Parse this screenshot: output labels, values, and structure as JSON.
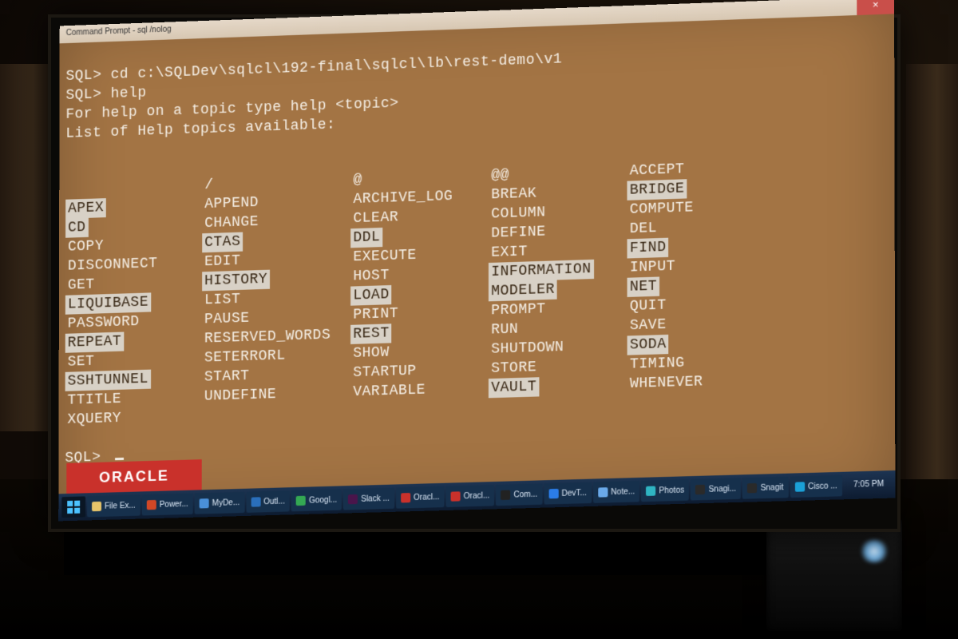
{
  "window": {
    "title": "Command Prompt - sql /nolog",
    "close_glyph": "×"
  },
  "terminal": {
    "prompt": "SQL>",
    "cmd_cd": "cd c:\\SQLDev\\sqlcl\\192-final\\sqlcl\\lb\\rest-demo\\v1",
    "cmd_help": "help",
    "help_hint": "For help on a topic type help <topic>",
    "help_header": "List of Help topics available:",
    "columns": [
      {
        "header": "",
        "items": [
          {
            "t": "APEX",
            "h": 1
          },
          {
            "t": "CD",
            "h": 1
          },
          {
            "t": "COPY",
            "h": 0
          },
          {
            "t": "DISCONNECT",
            "h": 0
          },
          {
            "t": "GET",
            "h": 0
          },
          {
            "t": "LIQUIBASE",
            "h": 1
          },
          {
            "t": "PASSWORD",
            "h": 0
          },
          {
            "t": "REPEAT",
            "h": 1
          },
          {
            "t": "SET",
            "h": 0
          },
          {
            "t": "SSHTUNNEL",
            "h": 1
          },
          {
            "t": "TTITLE",
            "h": 0
          },
          {
            "t": "XQUERY",
            "h": 0
          }
        ]
      },
      {
        "header": "/",
        "items": [
          {
            "t": "APPEND",
            "h": 0
          },
          {
            "t": "CHANGE",
            "h": 0
          },
          {
            "t": "CTAS",
            "h": 1
          },
          {
            "t": "EDIT",
            "h": 0
          },
          {
            "t": "HISTORY",
            "h": 1
          },
          {
            "t": "LIST",
            "h": 0
          },
          {
            "t": "PAUSE",
            "h": 0
          },
          {
            "t": "RESERVED_WORDS",
            "h": 0
          },
          {
            "t": "SETERRORL",
            "h": 0
          },
          {
            "t": "START",
            "h": 0
          },
          {
            "t": "UNDEFINE",
            "h": 0
          }
        ]
      },
      {
        "header": "@",
        "items": [
          {
            "t": "ARCHIVE_LOG",
            "h": 0
          },
          {
            "t": "CLEAR",
            "h": 0
          },
          {
            "t": "DDL",
            "h": 1
          },
          {
            "t": "EXECUTE",
            "h": 0
          },
          {
            "t": "HOST",
            "h": 0
          },
          {
            "t": "LOAD",
            "h": 1
          },
          {
            "t": "PRINT",
            "h": 0
          },
          {
            "t": "REST",
            "h": 1
          },
          {
            "t": "SHOW",
            "h": 0
          },
          {
            "t": "STARTUP",
            "h": 0
          },
          {
            "t": "VARIABLE",
            "h": 0
          }
        ]
      },
      {
        "header": "@@",
        "items": [
          {
            "t": "BREAK",
            "h": 0
          },
          {
            "t": "COLUMN",
            "h": 0
          },
          {
            "t": "DEFINE",
            "h": 0
          },
          {
            "t": "EXIT",
            "h": 0
          },
          {
            "t": "INFORMATION",
            "h": 1
          },
          {
            "t": "MODELER",
            "h": 1
          },
          {
            "t": "PROMPT",
            "h": 0
          },
          {
            "t": "RUN",
            "h": 0
          },
          {
            "t": "SHUTDOWN",
            "h": 0
          },
          {
            "t": "STORE",
            "h": 0
          },
          {
            "t": "VAULT",
            "h": 1
          }
        ]
      },
      {
        "header": "ACCEPT",
        "items": [
          {
            "t": "BRIDGE",
            "h": 1
          },
          {
            "t": "COMPUTE",
            "h": 0
          },
          {
            "t": "DEL",
            "h": 0
          },
          {
            "t": "FIND",
            "h": 1
          },
          {
            "t": "INPUT",
            "h": 0
          },
          {
            "t": "NET",
            "h": 1
          },
          {
            "t": "QUIT",
            "h": 0
          },
          {
            "t": "SAVE",
            "h": 0
          },
          {
            "t": "SODA",
            "h": 1
          },
          {
            "t": "TIMING",
            "h": 0
          },
          {
            "t": "WHENEVER",
            "h": 0
          }
        ]
      }
    ]
  },
  "badge": {
    "oracle": "ORACLE"
  },
  "taskbar": {
    "items": [
      {
        "label": "File Ex...",
        "color": "#e8c56a"
      },
      {
        "label": "Power...",
        "color": "#d24726"
      },
      {
        "label": "MyDe...",
        "color": "#4a90d9"
      },
      {
        "label": "Outl...",
        "color": "#2a6fbb"
      },
      {
        "label": "Googl...",
        "color": "#34a853"
      },
      {
        "label": "Slack ...",
        "color": "#4a154b"
      },
      {
        "label": "Oracl...",
        "color": "#c9312b"
      },
      {
        "label": "Oracl...",
        "color": "#c9312b"
      },
      {
        "label": "Com...",
        "color": "#222"
      },
      {
        "label": "DevT...",
        "color": "#2b7de9"
      },
      {
        "label": "Note...",
        "color": "#6aa9e9"
      },
      {
        "label": "Photos",
        "color": "#2fb4c2"
      },
      {
        "label": "Snagi...",
        "color": "#2a2a2a"
      },
      {
        "label": "Snagit",
        "color": "#2a2a2a"
      },
      {
        "label": "Cisco ...",
        "color": "#1ba0d7"
      }
    ],
    "clock": "7:05 PM"
  }
}
